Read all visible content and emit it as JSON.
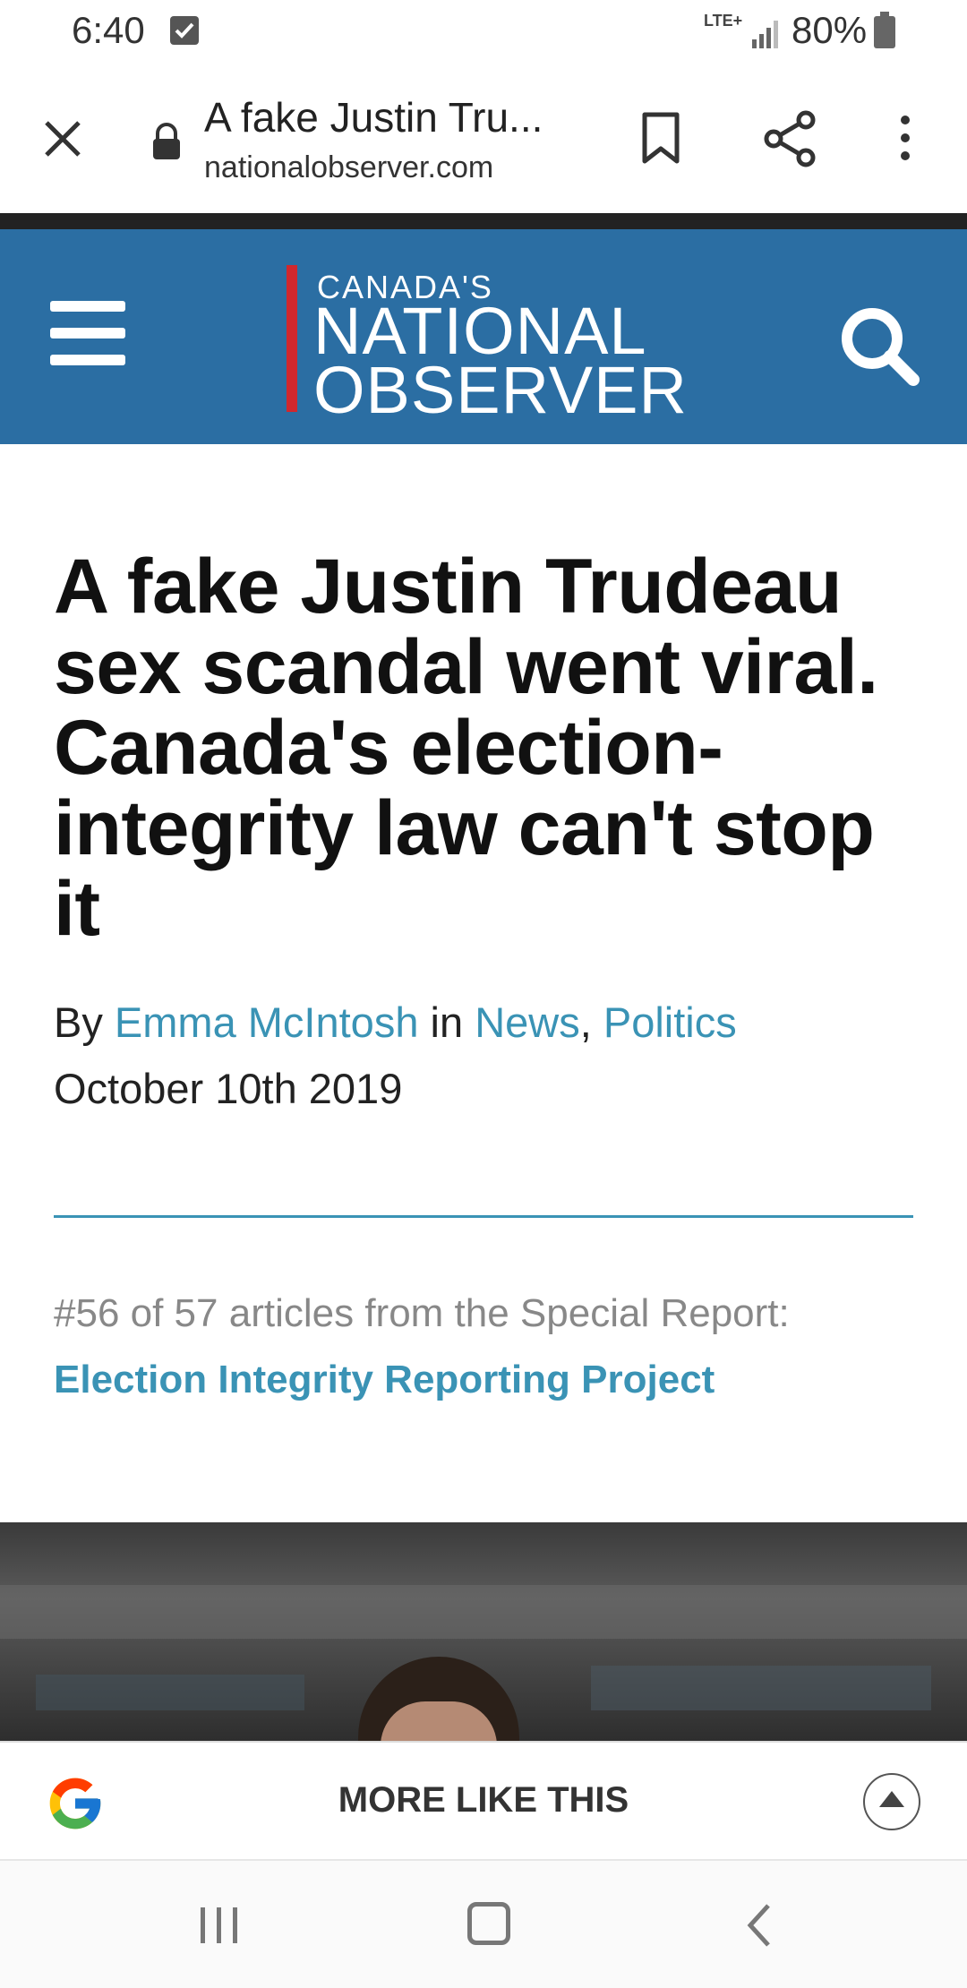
{
  "status_bar": {
    "time": "6:40",
    "network": "LTE+",
    "battery": "80%"
  },
  "browser": {
    "page_title": "A fake Justin Tru...",
    "url": "nationalobserver.com",
    "icons": [
      "close-icon",
      "lock-icon",
      "bookmark-icon",
      "share-icon",
      "more-vert-icon"
    ]
  },
  "site": {
    "logo_top": "CANADA'S",
    "logo_line1": "NATIONAL",
    "logo_line2": "OBSERVER",
    "brand_color": "#2b6ea3",
    "accent_color": "#d0282e",
    "link_color": "#3a93b5"
  },
  "article": {
    "headline": "A fake Justin Trudeau sex scandal went viral. Canada's election-integrity law can't stop it",
    "by": "By",
    "author": "Emma McIntosh",
    "in": "in",
    "category1": "News",
    "comma": ",",
    "category2": "Politics",
    "date": "October 10th 2019",
    "series_meta": "#56 of 57 articles from the Special Report:",
    "series_title": "Election Integrity Reporting Project"
  },
  "google_bar": {
    "label": "MORE LIKE THIS"
  }
}
